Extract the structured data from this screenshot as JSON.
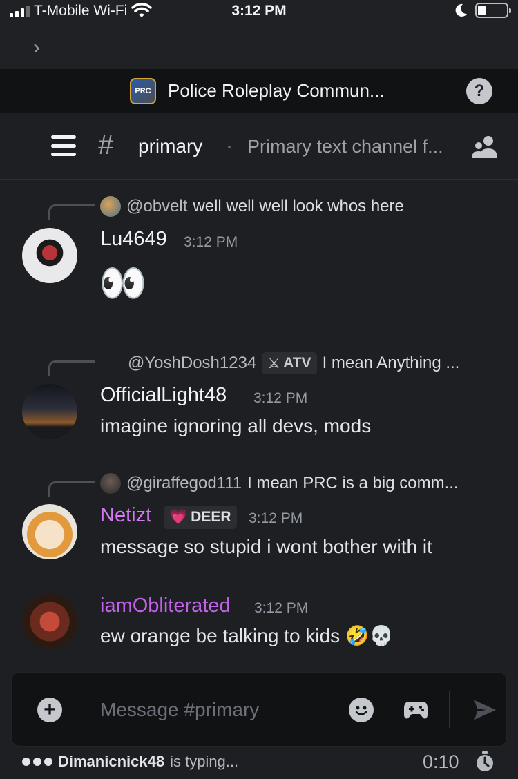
{
  "status_bar": {
    "carrier": "T-Mobile Wi-Fi",
    "time": "3:12 PM"
  },
  "server": {
    "icon_text": "PRC",
    "name": "Police Roleplay Commun...",
    "help_label": "?"
  },
  "channel": {
    "hash": "#",
    "name": "primary",
    "topic": "Primary text channel f..."
  },
  "messages": [
    {
      "reply": {
        "name": "@obvelt",
        "text": "well well well look whos here"
      },
      "username": "Lu4649",
      "username_color": "#f2f3f5",
      "time": "3:12 PM",
      "content": "👀"
    },
    {
      "reply": {
        "name": "@YoshDosh1234",
        "badge_icon": "⚔",
        "badge": "ATV",
        "text": "I mean Anything ..."
      },
      "username": "OfficialLight48",
      "username_color": "#f2f3f5",
      "time": "3:12 PM",
      "content": "imagine ignoring all devs, mods"
    },
    {
      "reply": {
        "name": "@giraffegod111",
        "text": "I mean PRC is a big comm..."
      },
      "username": "Netizt",
      "username_color": "#d57bf2",
      "badge_icon": "💗",
      "badge": "DEER",
      "time": "3:12 PM",
      "content": "message so stupid i wont bother with it"
    },
    {
      "username": "iamObliterated",
      "username_color": "#c162e8",
      "time": "3:12 PM",
      "content": "ew orange be talking to kids 🤣💀"
    }
  ],
  "composer": {
    "placeholder": "Message #primary"
  },
  "typing": {
    "name": "Dimanicnick48",
    "suffix": "is typing...",
    "timer": "0:10"
  },
  "colors": {
    "background": "#1e1f23",
    "header": "#111214",
    "accent_purple": "#c162e8"
  }
}
